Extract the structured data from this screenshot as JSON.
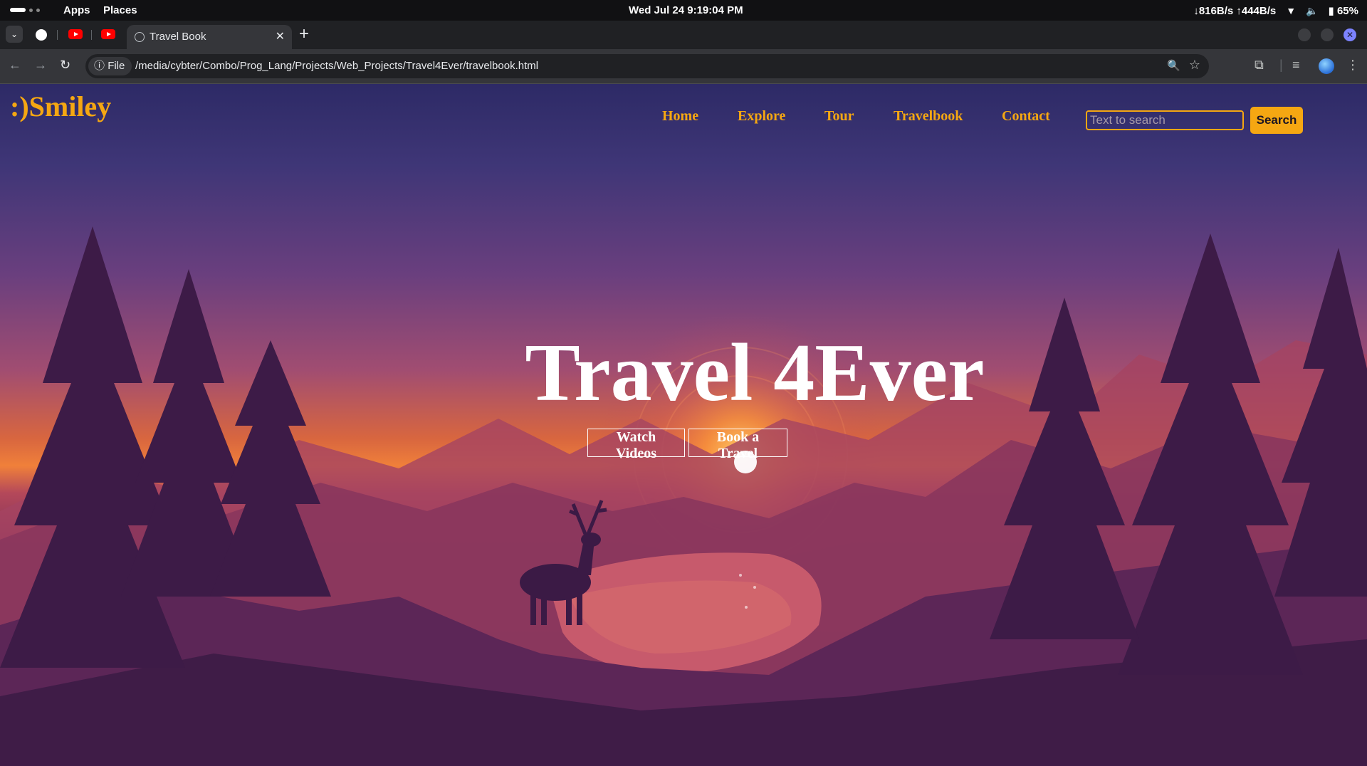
{
  "system_bar": {
    "apps_label": "Apps",
    "places_label": "Places",
    "datetime": "Wed Jul 24   9:19:04 PM",
    "network": "↓816B/s ↑444B/s",
    "battery": "65%"
  },
  "browser": {
    "tab_title": "Travel Book",
    "new_tab_symbol": "+",
    "url_chip": "File",
    "url": "/media/cybter/Combo/Prog_Lang/Projects/Web_Projects/Travel4Ever/travelbook.html"
  },
  "site": {
    "logo": ":)Smiley",
    "nav": [
      "Home",
      "Explore",
      "Tour",
      "Travelbook",
      "Contact"
    ],
    "search_placeholder": "Text to search",
    "search_button": "Search",
    "hero_title": "Travel 4Ever",
    "hero_buttons": [
      "Watch Videos",
      "Book a Travel"
    ],
    "accent_color": "#f5a712"
  }
}
